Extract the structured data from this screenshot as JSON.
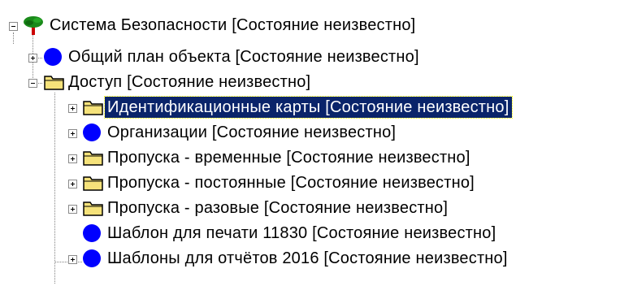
{
  "tree": {
    "root": {
      "label": "Система Безопасности [Состояние неизвестно]",
      "icon": "tree-icon",
      "expanded": true
    },
    "items": [
      {
        "label": "Общий план объекта [Состояние неизвестно]",
        "icon": "blue-circle-icon",
        "expanded": false,
        "has_children": true
      },
      {
        "label": "Доступ [Состояние неизвестно]",
        "icon": "folder-open-icon",
        "expanded": true,
        "has_children": true,
        "children": [
          {
            "label": "Идентификационные карты [Состояние неизвестно]",
            "icon": "folder-icon",
            "selected": true,
            "has_children": true
          },
          {
            "label": "Организации [Состояние неизвестно]",
            "icon": "blue-circle-icon",
            "has_children": true
          },
          {
            "label": "Пропуска - временные [Состояние неизвестно]",
            "icon": "folder-icon",
            "has_children": true
          },
          {
            "label": "Пропуска - постоянные [Состояние неизвестно]",
            "icon": "folder-icon",
            "has_children": true
          },
          {
            "label": "Пропуска - разовые [Состояние неизвестно]",
            "icon": "folder-icon",
            "has_children": true
          },
          {
            "label": "Шаблон для печати 11830 [Состояние неизвестно]",
            "icon": "blue-circle-icon",
            "has_children": false
          },
          {
            "label": "Шаблоны для отчётов 2016 [Состояние неизвестно]",
            "icon": "blue-circle-icon",
            "has_children": true
          }
        ]
      }
    ]
  },
  "colors": {
    "selection_bg": "#0a246a",
    "selection_text": "#ffffff",
    "folder_fill": "#f5e27a",
    "folder_stroke": "#000000",
    "circle_fill": "#0000ff",
    "tree_green": "#1a8a1a",
    "trunk_red": "#cc0000"
  }
}
